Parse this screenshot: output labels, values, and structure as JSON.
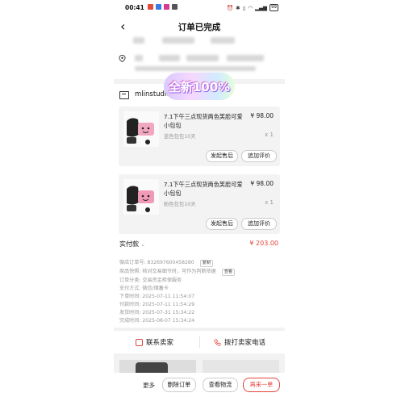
{
  "status_bar": {
    "time": "00:41",
    "battery": "99"
  },
  "nav": {
    "title": "订单已完成"
  },
  "badge": {
    "text": "全新100%"
  },
  "shop": {
    "name": "mlinstudio"
  },
  "items": [
    {
      "title": "7.1下午三点现货两色笑脸可爱小包包",
      "price": "¥ 98.00",
      "spec": "蓝色包包10天",
      "qty": "x 1",
      "btn_after": "发起售后",
      "btn_review": "追加评价"
    },
    {
      "title": "7.1下午三点现货两色笑脸可爱小包包",
      "price": "¥ 98.00",
      "spec": "粉色包包10天",
      "qty": "x 1",
      "btn_after": "发起售后",
      "btn_review": "追加评价"
    }
  ],
  "payment": {
    "label": "实付款",
    "amount": "¥ 203.00"
  },
  "info": [
    {
      "label": "微店订单号:",
      "value": "8326976004582​80",
      "action": "复制"
    },
    {
      "label": "商品快照:",
      "value": "核对交易细节时，可作为判断依据",
      "action": "查看"
    },
    {
      "label": "订单分类:",
      "value": "交易资金担保服务"
    },
    {
      "label": "支付方式:",
      "value": "微信/储蓄卡"
    },
    {
      "label": "下单时间:",
      "value": "2025-07-11 11:54:07"
    },
    {
      "label": "付款时间:",
      "value": "2025-07-11 11:54:29"
    },
    {
      "label": "发货时间:",
      "value": "2025-07-31 15:34:22"
    },
    {
      "label": "完成时间:",
      "value": "2025-08-07 15:34:24"
    }
  ],
  "contact": {
    "seller": "联系卖家",
    "phone": "拨打卖家电话"
  },
  "bottom": {
    "more": "更多",
    "delete": "删除订单",
    "logistics": "查看物流",
    "reorder": "再来一单"
  },
  "colors": {
    "accent": "#e0443a",
    "background": "#f2f2f2"
  }
}
